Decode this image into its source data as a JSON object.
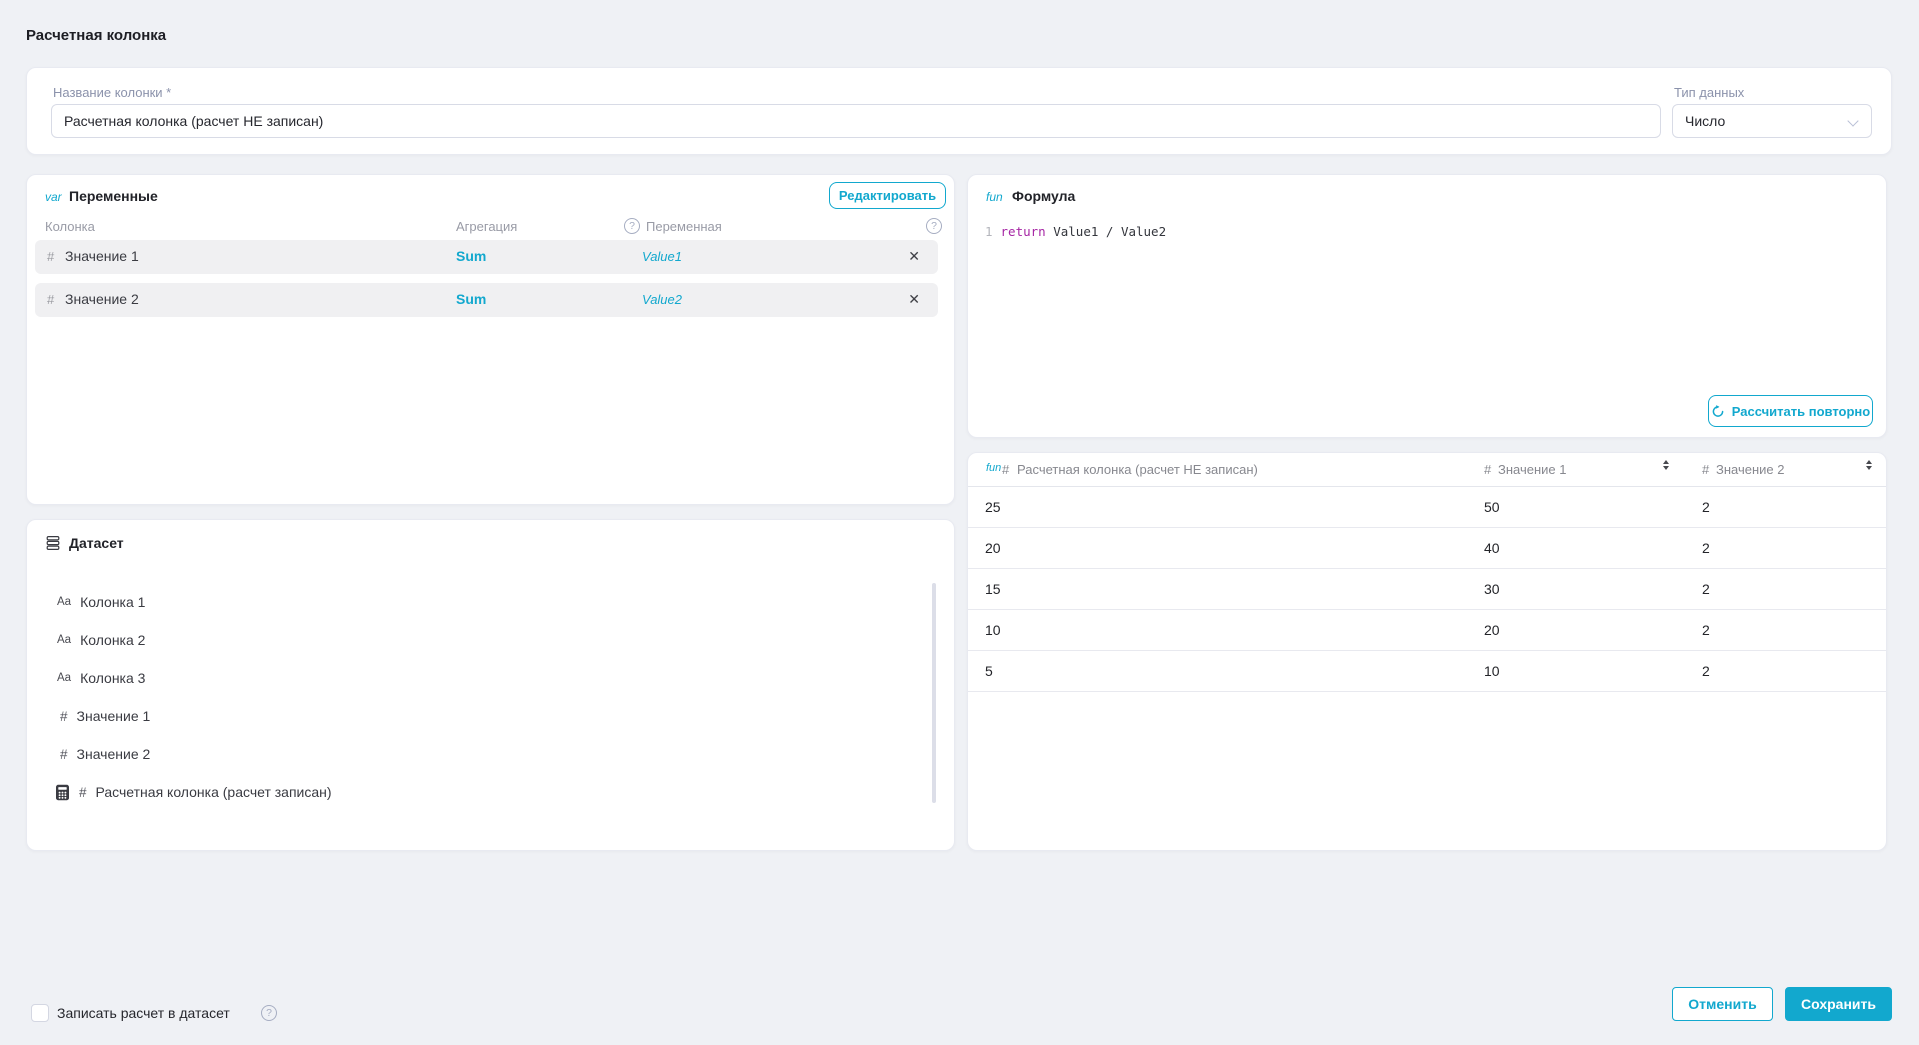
{
  "title": "Расчетная колонка",
  "colors": {
    "accent": "#12A8CE",
    "code_keyword": "#A626A4"
  },
  "name_field": {
    "label": "Название колонки *",
    "value": "Расчетная колонка (расчет НЕ записан)"
  },
  "type_field": {
    "label": "Тип данных",
    "value": "Число"
  },
  "variables": {
    "tag": "var",
    "title": "Переменные",
    "edit_button": "Редактировать",
    "headers": {
      "column": "Колонка",
      "aggregation": "Агрегация",
      "variable": "Переменная"
    },
    "rows": [
      {
        "type_icon": "#",
        "column": "Значение 1",
        "aggregation": "Sum",
        "variable": "Value1"
      },
      {
        "type_icon": "#",
        "column": "Значение 2",
        "aggregation": "Sum",
        "variable": "Value2"
      }
    ]
  },
  "dataset": {
    "title": "Датасет",
    "items": [
      {
        "icon": "Aa",
        "label": "Колонка 1"
      },
      {
        "icon": "Aa",
        "label": "Колонка 2"
      },
      {
        "icon": "Aa",
        "label": "Колонка 3"
      },
      {
        "icon": "#",
        "label": "Значение 1"
      },
      {
        "icon": "#",
        "label": "Значение 2"
      },
      {
        "icon": "#",
        "label": "Расчетная колонка (расчет записан)",
        "calculated": true
      }
    ]
  },
  "formula": {
    "tag": "fun",
    "title": "Формула",
    "line_number": "1",
    "keyword": "return",
    "expression": "Value1 / Value2",
    "recalc_button": "Рассчитать повторно"
  },
  "preview": {
    "columns": [
      {
        "tag": "fun",
        "type_icon": "#",
        "label": "Расчетная колонка (расчет НЕ записан)"
      },
      {
        "type_icon": "#",
        "label": "Значение 1"
      },
      {
        "type_icon": "#",
        "label": "Значение 2"
      }
    ],
    "rows": [
      [
        "25",
        "50",
        "2"
      ],
      [
        "20",
        "40",
        "2"
      ],
      [
        "15",
        "30",
        "2"
      ],
      [
        "10",
        "20",
        "2"
      ],
      [
        "5",
        "10",
        "2"
      ]
    ]
  },
  "footer": {
    "checkbox_label": "Записать расчет в датасет",
    "cancel": "Отменить",
    "save": "Сохранить"
  },
  "icons": {
    "help": "?",
    "close": "✕"
  }
}
